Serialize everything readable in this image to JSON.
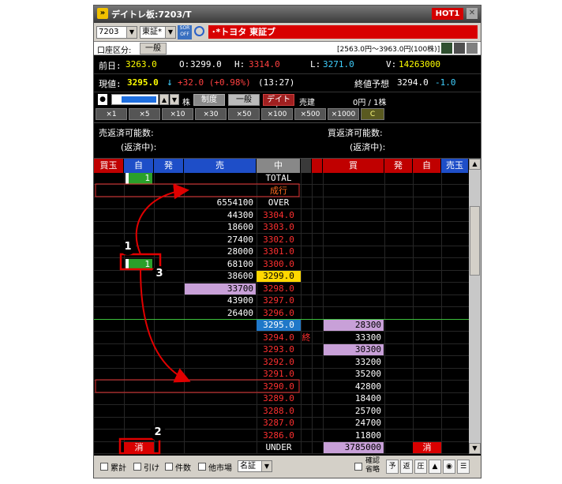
{
  "window": {
    "title": "デイトレ板:7203/T",
    "hot_label": "HOT1"
  },
  "toolbar": {
    "code": "7203",
    "market": "東証*",
    "sor_label": "SOR OFF",
    "stock_name": "･*トヨタ 東証ブ"
  },
  "account": {
    "label": "口座区分:",
    "value": "一般",
    "range": "[2563.0円～3963.0円(100株)]"
  },
  "quote": {
    "prev_label": "前日:",
    "prev": "3263.0",
    "open_label": "O:",
    "open": "3299.0",
    "high_label": "H:",
    "high": "3314.0",
    "low_label": "L:",
    "low": "3271.0",
    "vol_label": "V:",
    "vol": "14263000",
    "cur_label": "現値:",
    "cur": "3295.0",
    "arrow": "↓",
    "change": "+32.0 (+0.98%)",
    "time": "(13:27)",
    "close_label": "終値予想",
    "close_est": "3294.0",
    "close_diff": "-1.0"
  },
  "controls": {
    "unit": "株",
    "system_btn": "制度",
    "general_btn": "一般",
    "daytrade_btn": "デイトレ",
    "sell_btn": "売建",
    "price_info": "0円 / 1株"
  },
  "multipliers": [
    "×1",
    "×5",
    "×10",
    "×30",
    "×50",
    "×100",
    "×500",
    "×1000",
    "C"
  ],
  "positions": {
    "sell_label": "売返済可能数:",
    "sell_pending": "(返済中):",
    "buy_label": "買返済可能数:",
    "buy_pending": "(返済中):"
  },
  "board_headers": [
    "買玉",
    "自",
    "発",
    "売",
    "中",
    "買",
    "発",
    "自",
    "売玉"
  ],
  "board_rows": [
    {
      "self_sell": "1",
      "price": "TOTAL",
      "pt": "white"
    },
    {
      "price": "成行",
      "pt": "orange"
    },
    {
      "sell": "6554100",
      "price": "OVER",
      "pt": "white"
    },
    {
      "sell": "44300",
      "price": "3304.0",
      "pt": "red"
    },
    {
      "sell": "18600",
      "price": "3303.0",
      "pt": "red"
    },
    {
      "sell": "27400",
      "price": "3302.0",
      "pt": "red"
    },
    {
      "sell": "28000",
      "price": "3301.0",
      "pt": "red"
    },
    {
      "self_sell": "1",
      "sell": "68100",
      "price": "3300.0",
      "pt": "red"
    },
    {
      "sell": "38600",
      "price": "3299.0",
      "pt": "open"
    },
    {
      "sell": "33700",
      "price": "3298.0",
      "pt": "red",
      "sell_hl": true
    },
    {
      "sell": "43900",
      "price": "3297.0",
      "pt": "red"
    },
    {
      "sell": "26400",
      "price": "3296.0",
      "pt": "red"
    },
    {
      "price": "3295.0",
      "pt": "cur",
      "buy": "28300",
      "buy_hl": true
    },
    {
      "price": "3294.0",
      "pt": "red",
      "mark": "終",
      "buy": "33300"
    },
    {
      "price": "3293.0",
      "pt": "red",
      "buy": "30300",
      "buy_hl": true
    },
    {
      "price": "3292.0",
      "pt": "red",
      "buy": "33200"
    },
    {
      "price": "3291.0",
      "pt": "red",
      "buy": "35200"
    },
    {
      "price": "3290.0",
      "pt": "red",
      "buy": "42800"
    },
    {
      "price": "3289.0",
      "pt": "red",
      "buy": "18400"
    },
    {
      "price": "3288.0",
      "pt": "red",
      "buy": "25700"
    },
    {
      "price": "3287.0",
      "pt": "red",
      "buy": "24700"
    },
    {
      "price": "3286.0",
      "pt": "red",
      "buy": "11800"
    },
    {
      "price": "UNDER",
      "pt": "white",
      "buy": "3785000",
      "buy_hl": true,
      "cancel": "消"
    }
  ],
  "footer": {
    "cumulative": "累計",
    "pull": "引け",
    "count": "件数",
    "other_market": "他市場",
    "market_select": "名証",
    "confirm": "確認省略"
  },
  "annotations": [
    "1",
    "2",
    "3"
  ],
  "colors": {
    "accent_red": "#d80000",
    "sell_header": "#1e4ec8",
    "buy_header": "#c00000",
    "self_green": "#2aa02a"
  }
}
